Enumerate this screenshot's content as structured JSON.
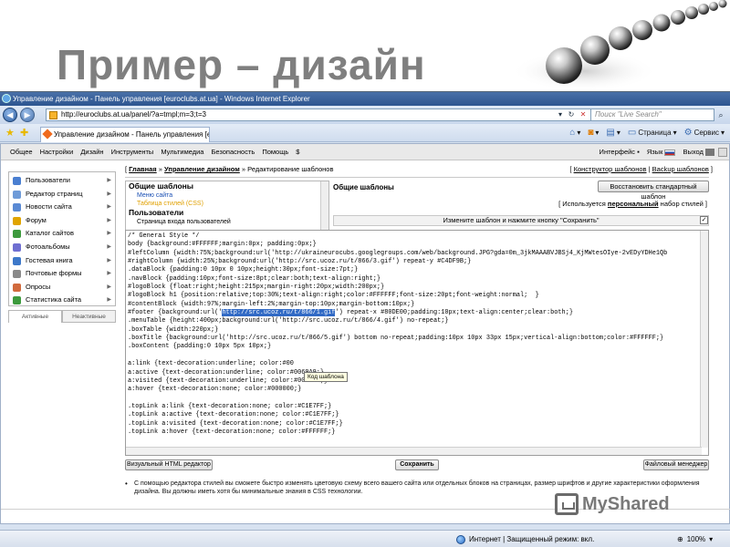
{
  "slide": {
    "title": "Пример – дизайн"
  },
  "browser": {
    "window_title": "Управление дизайном - Панель управления [euroclubs.at.ua] - Windows Internet Explorer",
    "url": "http://euroclubs.at.ua/panel/?a=tmpl;m=3;t=3",
    "search_placeholder": "Поиск \"Live Search\"",
    "tab_title": "Управление дизайном - Панель управления [e...",
    "tools": [
      "Страница",
      "Сервис"
    ]
  },
  "panel": {
    "menu": [
      "Общее",
      "Настройки",
      "Дизайн",
      "Инструменты",
      "Мультимедиа",
      "Безопасность",
      "Помощь",
      "$"
    ],
    "interface_label": "Интерфейс",
    "language_label": "Язык",
    "exit_label": "Выход",
    "nav_items": [
      {
        "label": "Пользователи",
        "icon": "users-icon",
        "color": "#4a7fd1"
      },
      {
        "label": "Редактор страниц",
        "icon": "pages-icon",
        "color": "#6f9bd8"
      },
      {
        "label": "Новости сайта",
        "icon": "news-icon",
        "color": "#5a8ad4"
      },
      {
        "label": "Форум",
        "icon": "forum-icon",
        "color": "#e0a400"
      },
      {
        "label": "Каталог сайтов",
        "icon": "catalog-icon",
        "color": "#3d9a3d"
      },
      {
        "label": "Фотоальбомы",
        "icon": "photo-icon",
        "color": "#6f6fd1"
      },
      {
        "label": "Гостевая книга",
        "icon": "guestbook-icon",
        "color": "#3d78c9"
      },
      {
        "label": "Почтовые формы",
        "icon": "mail-icon",
        "color": "#8a8a8a"
      },
      {
        "label": "Опросы",
        "icon": "polls-icon",
        "color": "#d16a3d"
      },
      {
        "label": "Статистика сайта",
        "icon": "stats-icon",
        "color": "#3d9a3d"
      }
    ],
    "nav_tabs": [
      "Активные",
      "Неактивные"
    ],
    "breadcrumb": {
      "home": "Главная",
      "design": "Управление дизайном",
      "current": "Редактирование шаблонов",
      "sep": "»"
    },
    "crumb_right": {
      "constructor": "Конструктор шаблонов",
      "backup": "Backup шаблонов"
    },
    "template_list": {
      "group1": "Общие шаблоны",
      "item1": "Меню сайта",
      "item2": "Таблица стилей (CSS)",
      "group2": "Пользователи",
      "item3": "Страница входа пользователей"
    },
    "info_title": "Общие шаблоны",
    "restore_button": "Восстановить стандартный шаблон",
    "used_prefix": "[ Используется ",
    "used_word": "персональный",
    "used_suffix": " набор стилей ]",
    "hint": "Измените шаблон и нажмите кнопку \"Сохранить\"",
    "check_mark": "✓",
    "code_lines": [
      "/* General Style */",
      "body {background:#FFFFFF;margin:0px; padding:0px;}",
      "#leftColumn {width:75%;background:url('http://ukraineurocubs.googlegroups.com/web/background.JPG?gda=0m_3jkMAAABVJBSj4_KjMWtesOIye-2vEDyYDHe1Qb",
      "#rightColumn {width:25%;background:url('http://src.ucoz.ru/t/866/3.gif') repeat-y #C4DF9B;}",
      ".dataBlock {padding:0 10px 0 10px;height:30px;font-size:7pt;}",
      ".navBlock {padding:10px;font-size:8pt;clear:both;text-align:right;}",
      "#logoBlock {float:right;height:215px;margin-right:20px;width:200px;}",
      "#logoBlock h1 {position:relative;top:30%;text-align:right;color:#FFFFFF;font-size:20pt;font-weight:normal;  }",
      "#contentBlock {width:97%;margin-left:2%;margin-top:10px;margin-bottom:10px;}",
      "#footer {background:url('|http://src.ucoz.ru/t/866/1.gif|') repeat-x #80DE00;padding:10px;text-align:center;clear:both;}",
      ".menuTable {height:400px;background:url('http://src.ucoz.ru/t/866/4.gif') no-repeat;}",
      ".boxTable {width:220px;}",
      ".boxTitle {background:url('http://src.ucoz.ru/t/866/5.gif') bottom no-repeat;padding:10px 10px 33px 15px;vertical-align:bottom;color:#FFFFFF;}",
      ".boxContent {padding:0 10px 5px 10px;}",
      "",
      "a:link {text-decoration:underline; color:#00",
      "a:active {text-decoration:underline; color:#0069A9;}",
      "a:visited {text-decoration:underline; color:#0069A9;}",
      "a:hover {text-decoration:none; color:#000000;}",
      "",
      ".topLink a:link {text-decoration:none; color:#C1E7FF;}",
      ".topLink a:active {text-decoration:none; color:#C1E7FF;}",
      ".topLink a:visited {text-decoration:none; color:#C1E7FF;}",
      ".topLink a:hover {text-decoration:none; color:#FFFFFF;}"
    ],
    "tooltip": "Код шаблона",
    "visual_editor_button": "Визуальный HTML редактор",
    "save_button": "Сохранить",
    "file_manager_button": "Файловый менеджер",
    "footer_note": "С помощью редактора стилей вы сможете быстро изменять цветовую схему всего вашего сайта или отдельных блоков на страницах, размер шрифтов и другие характеристики оформления дизайна. Вы должны иметь хотя бы минимальные знания в CSS технологии."
  },
  "status": {
    "zone": "Интернет | Защищенный режим: вкл.",
    "zoom": "100%"
  },
  "watermark": {
    "text": "MyShared"
  }
}
